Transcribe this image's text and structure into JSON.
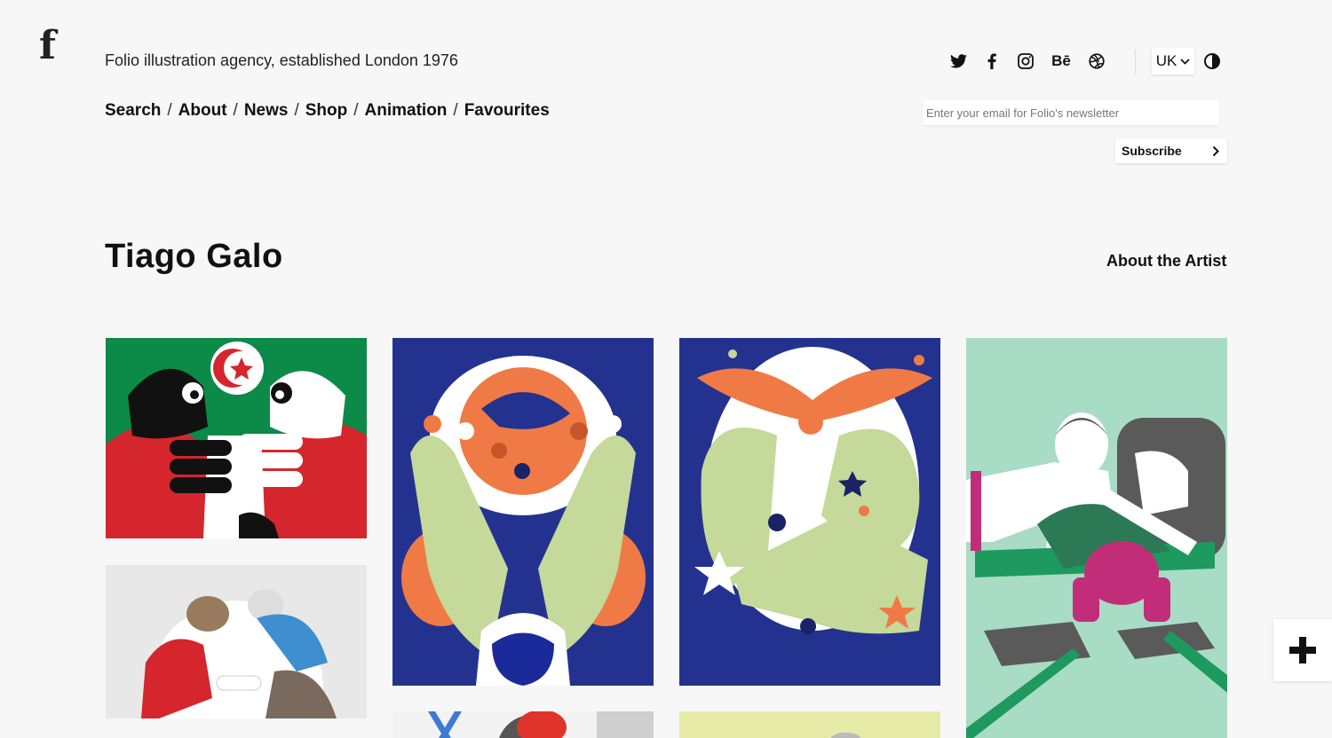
{
  "header": {
    "logo": "f",
    "tagline": "Folio illustration agency, established London 1976"
  },
  "nav": {
    "items": [
      "Search",
      "About",
      "News",
      "Shop",
      "Animation",
      "Favourites"
    ],
    "separator": "/"
  },
  "social": {
    "icons": [
      "twitter-icon",
      "facebook-icon",
      "instagram-icon",
      "behance-icon",
      "dribbble-icon"
    ],
    "behance_label": "Bē"
  },
  "region": {
    "selected": "UK"
  },
  "newsletter": {
    "placeholder": "Enter your email for Folio's newsletter",
    "value": "",
    "button_label": "Subscribe"
  },
  "artist": {
    "name": "Tiago Galo",
    "about_link": "About the Artist"
  },
  "gallery": {
    "tiles": [
      {
        "name": "artwork-handshake",
        "bg": "#0c8a48"
      },
      {
        "name": "artwork-hands-earth",
        "bg": "#24328f"
      },
      {
        "name": "artwork-green-figure",
        "bg": "#24328f"
      },
      {
        "name": "artwork-desk-cat",
        "bg": "#a8dcc4"
      },
      {
        "name": "artwork-embrace",
        "bg": "#e8e8e8"
      },
      {
        "name": "artwork-bottom-1",
        "bg": "#f2f2f2"
      },
      {
        "name": "artwork-bottom-2",
        "bg": "#e6eca8"
      }
    ]
  },
  "colors": {
    "background": "#f7f7f7",
    "text": "#111111",
    "orange": "#f07a45",
    "pale_green": "#c4d99a",
    "navy": "#24328f",
    "red": "#d4262c",
    "magenta": "#c22d7a"
  },
  "floating": {
    "icon": "plus-icon"
  }
}
